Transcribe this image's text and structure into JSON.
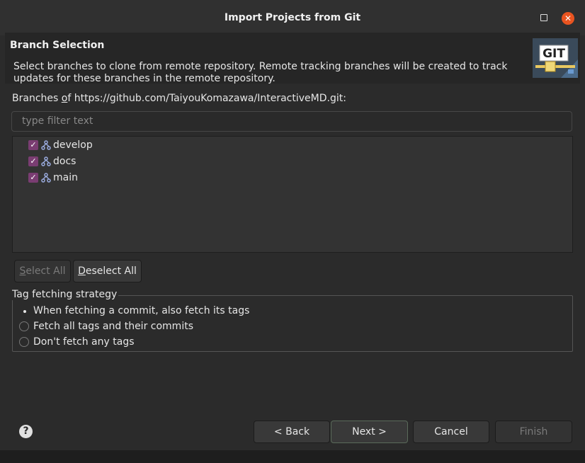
{
  "window": {
    "title": "Import Projects from Git",
    "close_glyph": "✕"
  },
  "header": {
    "title": "Branch Selection",
    "description": "Select branches to clone from remote repository. Remote tracking branches will be created to track updates for these branches in the remote repository.",
    "logo_text": "GIT"
  },
  "branches": {
    "label_prefix": "Branches ",
    "label_mnemonic": "o",
    "label_rest": "f https://github.com/TaiyouKomazawa/InteractiveMD.git:",
    "filter_placeholder": "type filter text",
    "items": [
      {
        "label": "develop",
        "checked": true
      },
      {
        "label": "docs",
        "checked": true
      },
      {
        "label": "main",
        "checked": true
      }
    ]
  },
  "selection_buttons": {
    "select_all_mnemonic": "S",
    "select_all_rest": "elect All",
    "deselect_all_mnemonic": "D",
    "deselect_all_rest": "eselect All"
  },
  "tag_strategy": {
    "label": "Tag fetching strategy",
    "options": [
      {
        "label": "When fetching a commit, also fetch its tags",
        "selected": true
      },
      {
        "label": "Fetch all tags and their commits",
        "selected": false
      },
      {
        "label": "Don't fetch any tags",
        "selected": false
      }
    ]
  },
  "footer": {
    "help_glyph": "?",
    "back_label": "< Back",
    "next_label": "Next >",
    "cancel_label": "Cancel",
    "finish_label": "Finish"
  },
  "colors": {
    "accent": "#7a3d72",
    "close": "#e95420",
    "background": "#2b2b2b"
  }
}
